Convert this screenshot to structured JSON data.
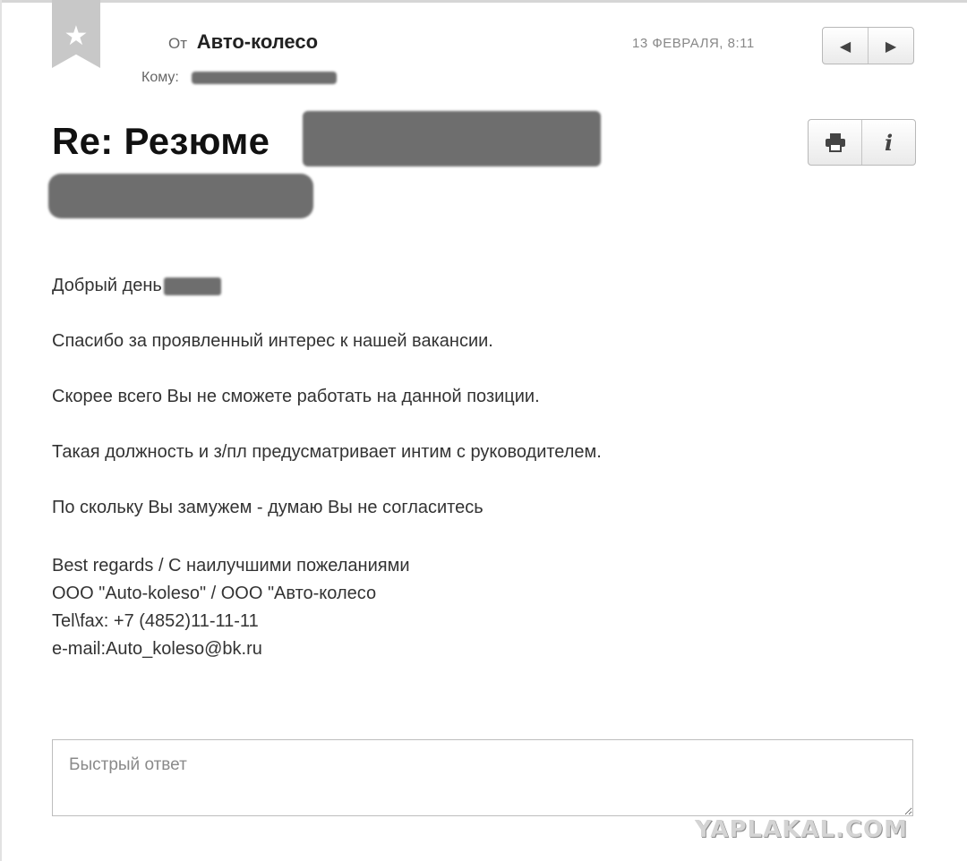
{
  "header": {
    "from_label": "От",
    "sender": "Авто-колесо",
    "to_label": "Кому:",
    "date": "13 ФЕВРАЛЯ, 8:11"
  },
  "subject": "Re: Резюме",
  "body": {
    "greeting": "Добрый день",
    "paragraphs": [
      "Спасибо за проявленный интерес к нашей вакансии.",
      "Скорее всего Вы не сможете работать на данной позиции.",
      "Такая должность и з/пл предусматривает интим с руководителем.",
      "По скольку Вы замужем - думаю Вы не согласитесь"
    ],
    "signature": [
      "Best regards / С наилучшими пожеланиями",
      "ООО \"Auto-koleso\" / ООО \"Авто-колесо",
      "Tel\\fax: +7 (4852)11-11-11",
      "e-mail:Auto_koleso@bk.ru"
    ]
  },
  "quick_reply": {
    "placeholder": "Быстрый ответ"
  },
  "watermark": "YAPLAKAL.COM",
  "icons": {
    "flag": "star-icon",
    "prev": "chevron-left-icon",
    "next": "chevron-right-icon",
    "print": "print-icon",
    "info": "info-icon"
  }
}
